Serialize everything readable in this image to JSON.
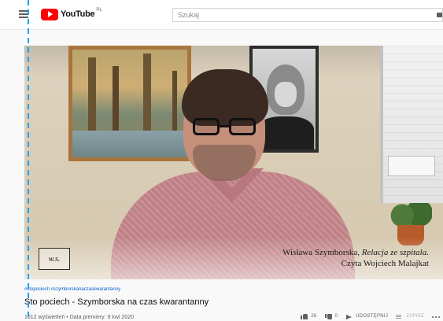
{
  "header": {
    "logo_text": "YouTube",
    "logo_region": "PL",
    "search_placeholder": "Szukaj"
  },
  "player": {
    "caption_line1_prefix": "Wisława Szymborska,",
    "caption_line1_italic": "Relacja ze szpitala.",
    "caption_line2": "Czyta Wojciech Malajkat",
    "badge_text": "w.s."
  },
  "video": {
    "hashtags": "#stopociech #szymborskanaczaskwarantanny",
    "title": "Sto pociech - Szymborska na czas kwarantanny",
    "views_and_date": "1012 wyświetleń • Data premiery: 9 kwi 2020"
  },
  "actions": {
    "likes": "26",
    "dislikes": "0",
    "share_label": "UDOSTĘPNIJ",
    "save_label": "ZAPISZ",
    "more_label": "..."
  },
  "colors": {
    "brand_red": "#ff0000",
    "link_blue": "#065fd4",
    "marker_blue": "#18a3ff"
  },
  "icons": [
    "hamburger-menu-icon",
    "youtube-logo-icon",
    "search-icon",
    "thumb-up-icon",
    "thumb-down-icon",
    "share-icon",
    "save-icon",
    "more-icon"
  ]
}
